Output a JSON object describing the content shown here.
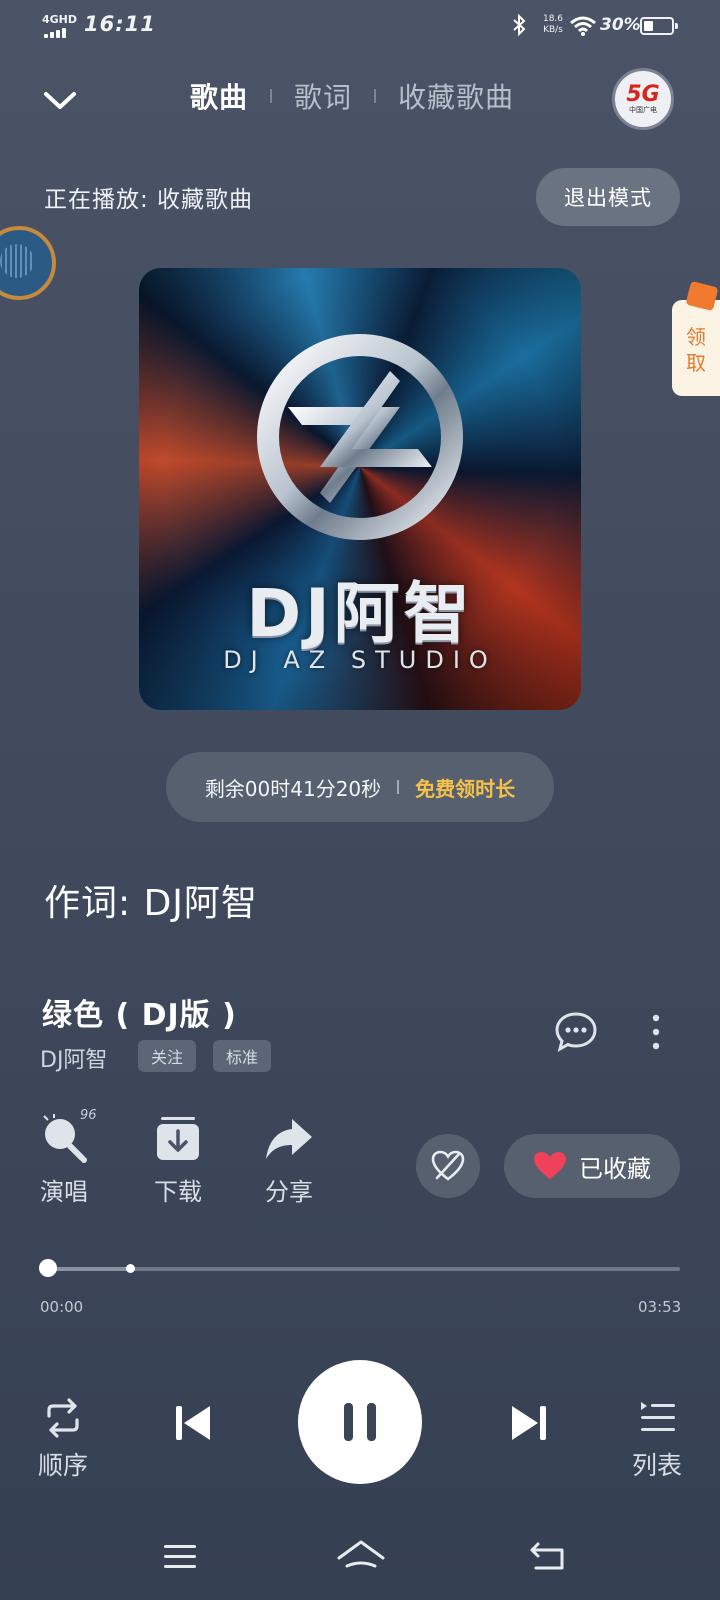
{
  "status_bar": {
    "network": "4GHD",
    "time": "16:11",
    "net_speed_value": "18.6",
    "net_speed_unit": "KB/s",
    "battery": "30%",
    "battery_level": 0.3
  },
  "header": {
    "tabs": [
      {
        "label": "歌曲",
        "active": true
      },
      {
        "label": "歌词",
        "active": false
      },
      {
        "label": "收藏歌曲",
        "active": false
      }
    ],
    "avatar_text": "5G",
    "avatar_sub": "中国广电"
  },
  "now_playing": {
    "label": "正在播放: 收藏歌曲",
    "exit_mode": "退出模式"
  },
  "promo_tab": {
    "label": "领取"
  },
  "album": {
    "title": "DJ阿智",
    "subtitle": "DJ AZ STUDIO"
  },
  "timer": {
    "remaining": "剩余00时41分20秒",
    "free_extend": "免费领时长"
  },
  "lyric_line": "作词: DJ阿智",
  "song": {
    "title": "绿色 ( DJ版 )",
    "artist": "DJ阿智",
    "follow": "关注",
    "quality": "标准"
  },
  "actions": {
    "sing": "演唱",
    "sing_count": "96",
    "download": "下载",
    "share": "分享",
    "favorited": "已收藏"
  },
  "progress": {
    "current": "00:00",
    "total": "03:53",
    "played_fraction": 0.0,
    "buffered_fraction": 0.13
  },
  "controls": {
    "order": "顺序",
    "list": "列表"
  },
  "colors": {
    "background": "#434d5f",
    "accent_yellow": "#f6c14a",
    "heart_red": "#f0415a",
    "promo_orange": "#e57a30"
  }
}
